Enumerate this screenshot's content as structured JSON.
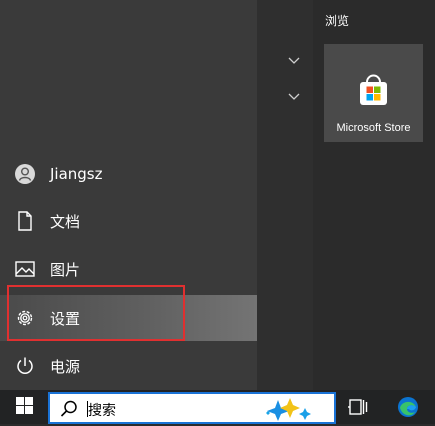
{
  "start_menu": {
    "user": {
      "name": "Jiangsz",
      "icon": "user-avatar-icon"
    },
    "items": [
      {
        "label": "文档",
        "icon": "document-icon"
      },
      {
        "label": "图片",
        "icon": "pictures-icon"
      },
      {
        "label": "设置",
        "icon": "gear-icon"
      },
      {
        "label": "电源",
        "icon": "power-icon"
      }
    ],
    "highlight_color": "#e03030"
  },
  "tiles": {
    "group_title": "浏览",
    "items": [
      {
        "label": "Microsoft Store",
        "icon": "microsoft-store-icon"
      }
    ]
  },
  "taskbar": {
    "search_text": "搜索",
    "accent": "#1a73d6"
  }
}
